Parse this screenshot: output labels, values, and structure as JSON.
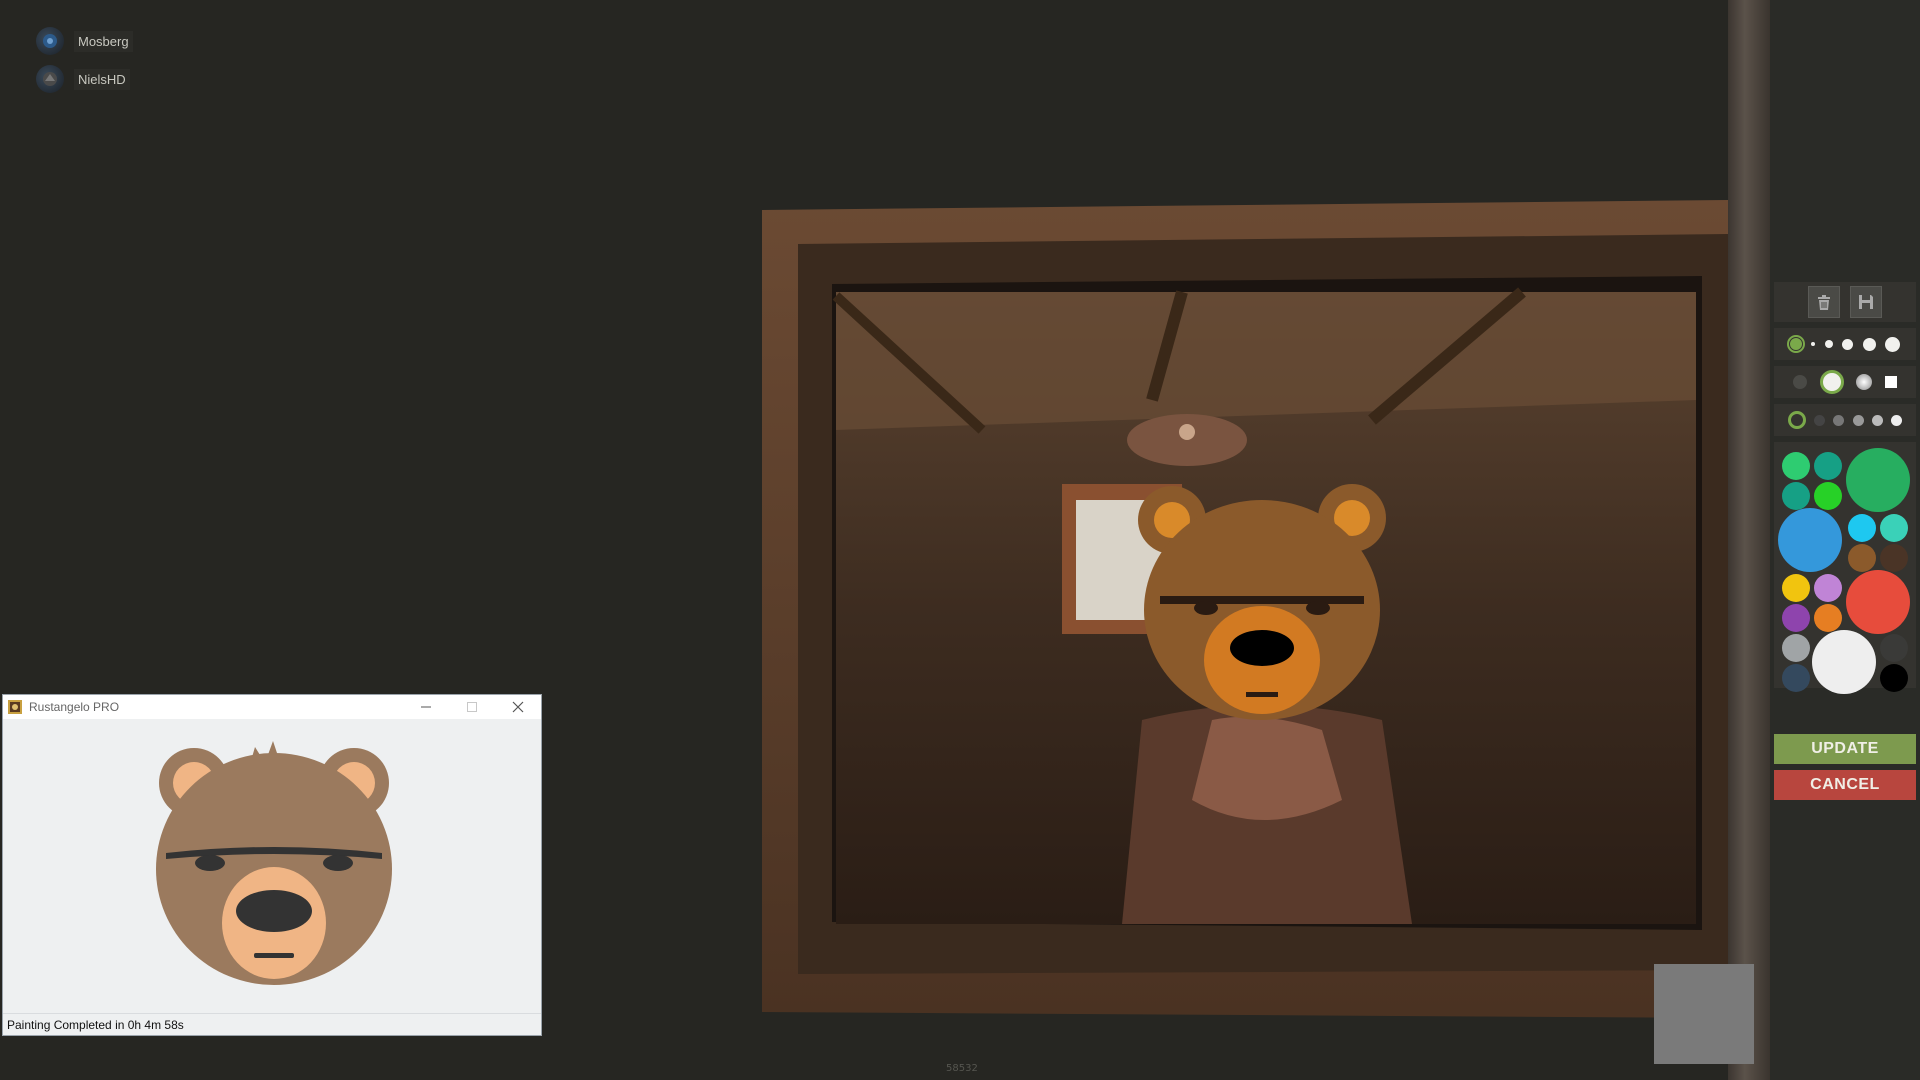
{
  "players": [
    {
      "name": "Mosberg"
    },
    {
      "name": "NielsHD"
    }
  ],
  "tools": {
    "trash_icon": "trash-icon",
    "save_icon": "save-icon",
    "update_label": "UPDATE",
    "cancel_label": "CANCEL"
  },
  "palette_colors": {
    "green": "#2ecc71",
    "teal": "#16a085",
    "bright_green": "#27d127",
    "big_green": "#27ae60",
    "blue": "#3498db",
    "cyan": "#1ec8f0",
    "aqua": "#3ad1b8",
    "brown": "#8b5a2b",
    "dark_brown": "#4a3426",
    "yellow": "#f1c40f",
    "lilac": "#c084d6",
    "red": "#e74c3c",
    "purple": "#8e44ad",
    "orange": "#e67e22",
    "gray": "#a0a4a6",
    "white": "#eeeeee",
    "dark_gray": "#3a3a38",
    "navy": "#34495e",
    "black": "#000000"
  },
  "app_window": {
    "title": "Rustangelo PRO",
    "status": "Painting Completed in 0h 4m 58s"
  },
  "bottom_code": "58532"
}
